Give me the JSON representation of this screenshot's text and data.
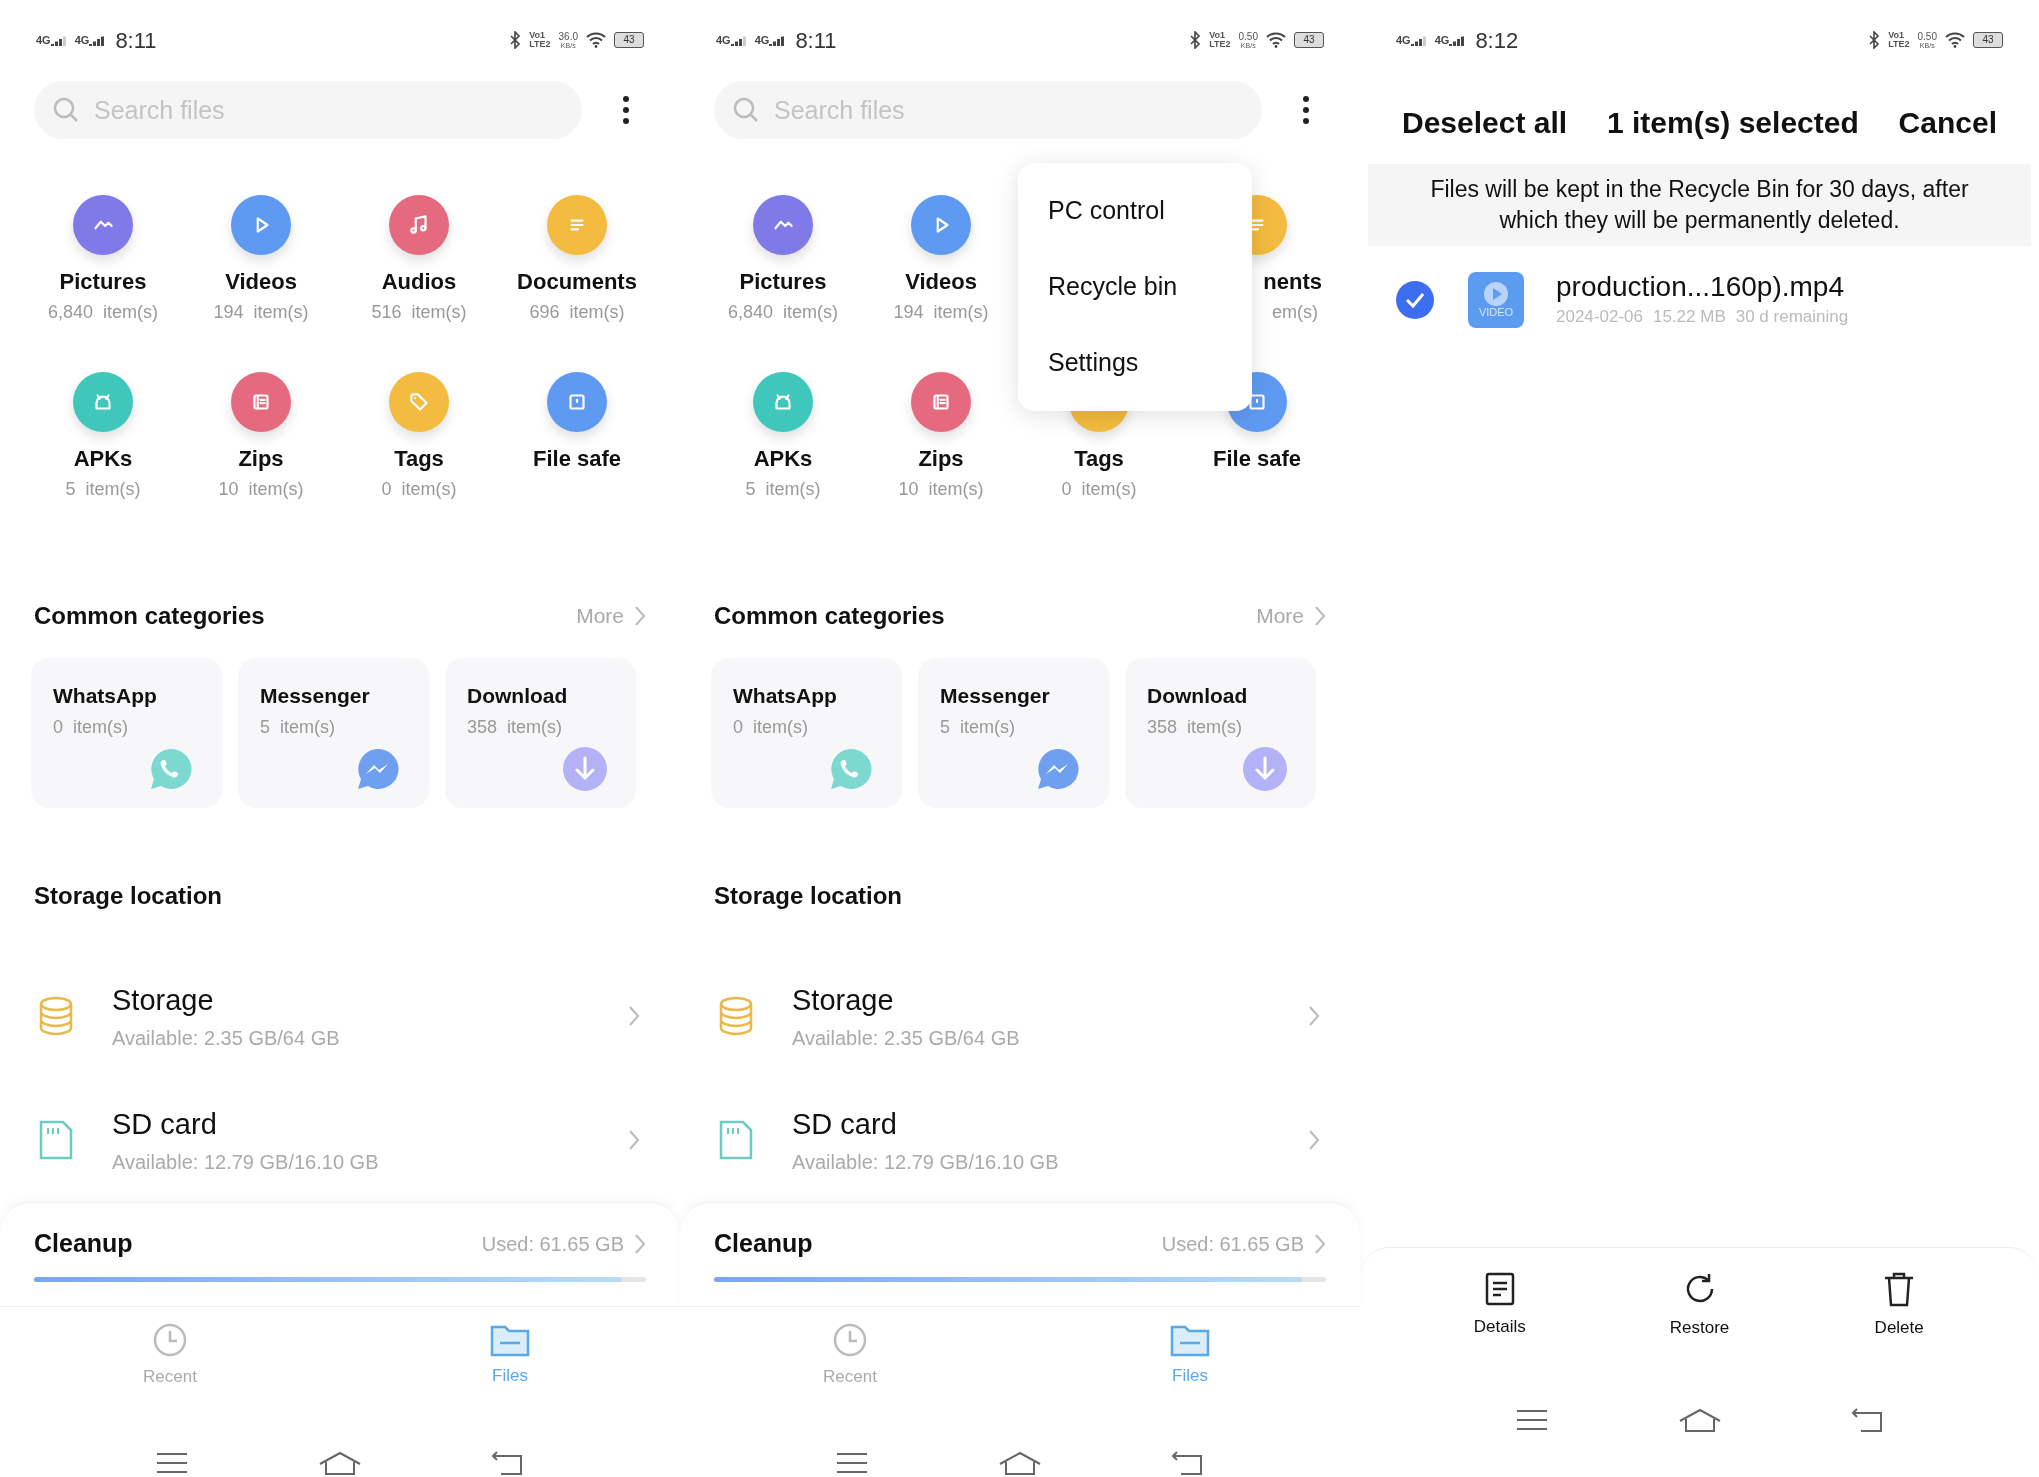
{
  "screens": [
    {
      "kind": "home",
      "status_bar": {
        "networks": [
          "4G",
          "4G"
        ],
        "time": "8:11",
        "volte": [
          "Vo1",
          "LTE2"
        ],
        "speed": [
          "36.0",
          "KB/s"
        ],
        "battery": "43"
      },
      "search": {
        "placeholder": "Search files"
      },
      "categories": [
        {
          "kind": "full",
          "label": "Pictures",
          "count": "6,840  item(s)",
          "color": "#8079e8"
        },
        {
          "kind": "full",
          "label": "Videos",
          "count": "194  item(s)",
          "color": "#5f9af2"
        },
        {
          "kind": "full",
          "label": "Audios",
          "count": "516  item(s)",
          "color": "#e66a7f"
        },
        {
          "kind": "full",
          "label": "Documents",
          "count": "696  item(s)",
          "color": "#f3bb3f"
        },
        {
          "kind": "full",
          "label": "APKs",
          "count": "5  item(s)",
          "color": "#3fc7bb"
        },
        {
          "kind": "full",
          "label": "Zips",
          "count": "10  item(s)",
          "color": "#e66a7f"
        },
        {
          "kind": "full",
          "label": "Tags",
          "count": "0  item(s)",
          "color": "#f3bb3f"
        },
        {
          "kind": "full",
          "label": "File safe",
          "color": "#5f9af2"
        }
      ],
      "common": {
        "title": "Common categories",
        "more": "More",
        "cards": [
          {
            "name": "WhatsApp",
            "count": "0  item(s)",
            "color": "#7dd9d0"
          },
          {
            "name": "Messenger",
            "count": "5  item(s)",
            "color": "#6fa0f0"
          },
          {
            "name": "Download",
            "count": "358  item(s)",
            "color": "#b4b2f6"
          }
        ]
      },
      "storage": {
        "title": "Storage location",
        "items": [
          {
            "name": "Storage",
            "detail": "Available: 2.35 GB/64 GB"
          },
          {
            "name": "SD card",
            "detail": "Available: 12.79 GB/16.10 GB"
          }
        ]
      },
      "cleanup": {
        "title": "Cleanup",
        "used": "Used: 61.65 GB",
        "level": 0.96
      },
      "nav": [
        {
          "label": "Recent",
          "selected": false
        },
        {
          "label": "Files",
          "selected": true
        }
      ]
    },
    {
      "kind": "home",
      "status_bar": {
        "networks": [
          "4G",
          "4G"
        ],
        "time": "8:11",
        "volte": [
          "Vo1",
          "LTE2"
        ],
        "speed": [
          "0.50",
          "KB/s"
        ],
        "battery": "43"
      },
      "search": {
        "placeholder": "Search files"
      },
      "categories": [
        {
          "kind": "full",
          "label": "Pictures",
          "count": "6,840  item(s)",
          "color": "#8079e8"
        },
        {
          "kind": "full",
          "label": "Videos",
          "count": "194  item(s)",
          "color": "#5f9af2"
        },
        {
          "kind": "covered"
        },
        {
          "kind": "clipped",
          "label": "nents",
          "count": "em(s)",
          "color": "#f3bb3f"
        },
        {
          "kind": "full",
          "label": "APKs",
          "count": "5  item(s)",
          "color": "#3fc7bb"
        },
        {
          "kind": "full",
          "label": "Zips",
          "count": "10  item(s)",
          "color": "#e66a7f"
        },
        {
          "kind": "icon_covered",
          "label": "Tags",
          "count": "0  item(s)",
          "color": "#f3bb3f"
        },
        {
          "kind": "full",
          "label": "File safe",
          "color": "#5f9af2"
        }
      ],
      "menu": [
        "PC control",
        "Recycle bin",
        "Settings"
      ],
      "common": {
        "title": "Common categories",
        "more": "More",
        "cards": [
          {
            "name": "WhatsApp",
            "count": "0  item(s)",
            "color": "#7dd9d0"
          },
          {
            "name": "Messenger",
            "count": "5  item(s)",
            "color": "#6fa0f0"
          },
          {
            "name": "Download",
            "count": "358  item(s)",
            "color": "#b4b2f6"
          }
        ]
      },
      "storage": {
        "title": "Storage location",
        "items": [
          {
            "name": "Storage",
            "detail": "Available: 2.35 GB/64 GB"
          },
          {
            "name": "SD card",
            "detail": "Available: 12.79 GB/16.10 GB"
          }
        ]
      },
      "cleanup": {
        "title": "Cleanup",
        "used": "Used: 61.65 GB",
        "level": 0.96
      },
      "nav": [
        {
          "label": "Recent",
          "selected": false
        },
        {
          "label": "Files",
          "selected": true
        }
      ]
    },
    {
      "kind": "recycle",
      "status_bar": {
        "networks": [
          "4G",
          "4G"
        ],
        "time": "8:12",
        "volte": [
          "Vo1",
          "LTE2"
        ],
        "speed": [
          "0.50",
          "KB/s"
        ],
        "battery": "43"
      },
      "header": {
        "left": "Deselect all",
        "title": "1 item(s) selected",
        "right": "Cancel"
      },
      "notice": "Files will be kept in the Recycle Bin for 30 days, after which they will be permanently deleted.",
      "files": [
        {
          "name": "production...160p).mp4",
          "checked": true,
          "thumb": "VIDEO",
          "meta": [
            "2024-02-06",
            "15.22 MB",
            "30 d remaining"
          ]
        }
      ],
      "actions": [
        "Details",
        "Restore",
        "Delete"
      ]
    }
  ]
}
